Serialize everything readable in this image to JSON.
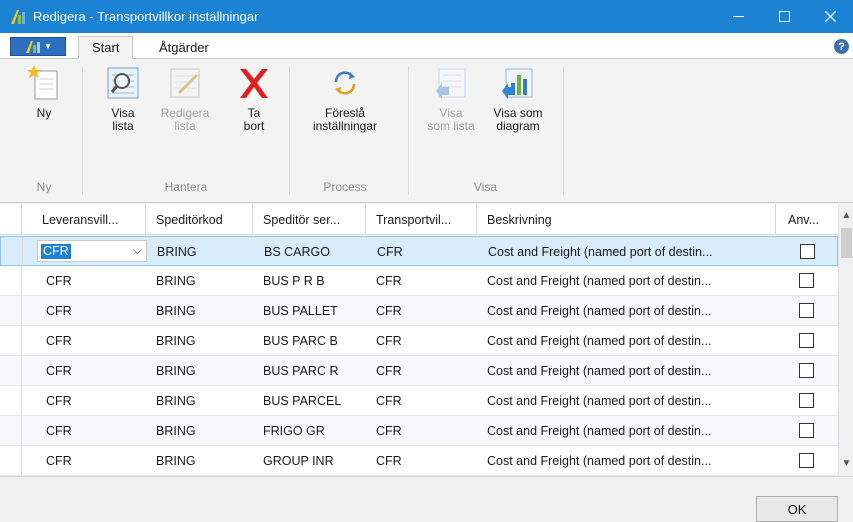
{
  "window": {
    "title": "Redigera - Transportvillkor inställningar",
    "minimize": "—",
    "maximize": "☐",
    "close": "✕",
    "accent": "#1c83d4"
  },
  "ribbon_tabs": {
    "menu_caret": "▾",
    "start": "Start",
    "actions": "Åtgärder",
    "help": "?"
  },
  "ribbon": {
    "new": {
      "label": "Ny",
      "icon": "new-document-icon"
    },
    "view_list": {
      "label": "Visa\nlista",
      "icon": "view-list-icon"
    },
    "edit_list": {
      "label": "Redigera\nlista",
      "icon": "edit-list-icon"
    },
    "delete": {
      "label": "Ta\nbort",
      "icon": "delete-x-icon"
    },
    "suggest": {
      "label": "Föreslå\ninställningar",
      "icon": "suggest-settings-icon"
    },
    "show_as_list": {
      "label": "Visa\nsom lista",
      "icon": "show-as-list-icon"
    },
    "show_as_chart": {
      "label": "Visa som\ndiagram",
      "icon": "show-as-chart-icon"
    },
    "groups": {
      "new": "Ny",
      "manage": "Hantera",
      "process": "Process",
      "view": "Visa"
    }
  },
  "table": {
    "columns": [
      "Leveransvill...",
      "Speditörkod",
      "Speditör ser...",
      "Transportvil...",
      "Beskrivning",
      "Anv..."
    ],
    "rows": [
      [
        "CFR",
        "BRING",
        "BS CARGO",
        "CFR",
        "Cost and Freight (named port of destin..."
      ],
      [
        "CFR",
        "BRING",
        "BUS P R B",
        "CFR",
        "Cost and Freight (named port of destin..."
      ],
      [
        "CFR",
        "BRING",
        "BUS PALLET",
        "CFR",
        "Cost and Freight (named port of destin..."
      ],
      [
        "CFR",
        "BRING",
        "BUS PARC B",
        "CFR",
        "Cost and Freight (named port of destin..."
      ],
      [
        "CFR",
        "BRING",
        "BUS PARC R",
        "CFR",
        "Cost and Freight (named port of destin..."
      ],
      [
        "CFR",
        "BRING",
        "BUS PARCEL",
        "CFR",
        "Cost and Freight (named port of destin..."
      ],
      [
        "CFR",
        "BRING",
        "FRIGO GR",
        "CFR",
        "Cost and Freight (named port of destin..."
      ],
      [
        "CFR",
        "BRING",
        "GROUP INR",
        "CFR",
        "Cost and Freight (named port of destin..."
      ]
    ],
    "editor_caret": "⌵"
  },
  "scroll": {
    "up": "▲",
    "down": "▼"
  },
  "footer": {
    "ok": "OK"
  }
}
